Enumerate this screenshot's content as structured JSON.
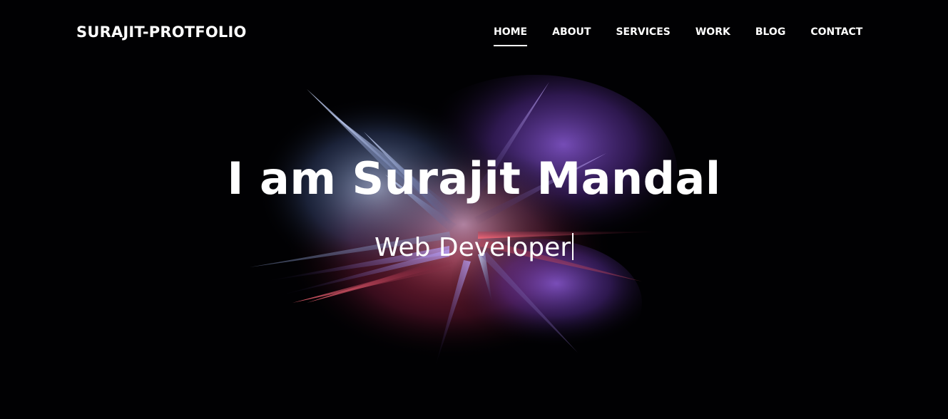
{
  "brand": {
    "label": "SURAJIT-PROTFOLIO"
  },
  "nav": {
    "items": [
      {
        "label": "HOME",
        "active": true
      },
      {
        "label": "ABOUT"
      },
      {
        "label": "SERVICES"
      },
      {
        "label": "WORK"
      },
      {
        "label": "BLOG"
      },
      {
        "label": "CONTACT"
      }
    ]
  },
  "hero": {
    "title": "I am Surajit Mandal",
    "subtitle": "Web Developer"
  },
  "colors": {
    "background": "#010103",
    "text": "#ffffff",
    "accent_purple": "#7a4bc8",
    "accent_red": "#c0314a",
    "accent_blue": "#9fb4e0"
  }
}
